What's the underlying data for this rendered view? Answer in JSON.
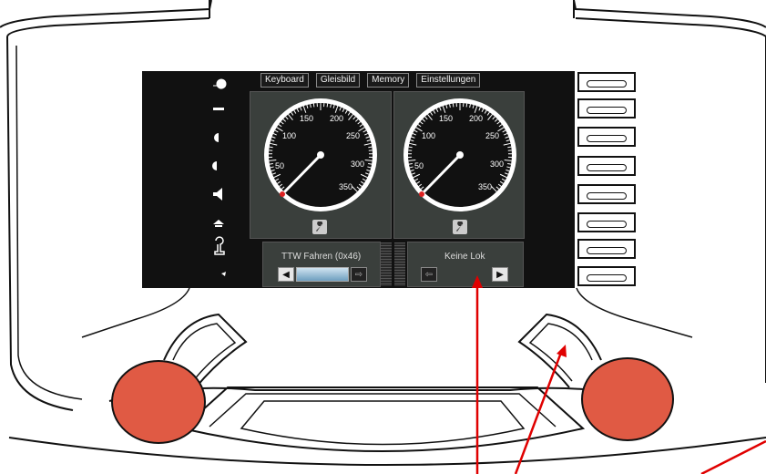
{
  "menu": {
    "items": [
      "Keyboard",
      "Gleisbild",
      "Memory",
      "Einstellungen"
    ]
  },
  "gauges": [
    {
      "ticks": [
        "50",
        "100",
        "150",
        "200",
        "250",
        "300",
        "350"
      ],
      "value": 0
    },
    {
      "ticks": [
        "50",
        "100",
        "150",
        "200",
        "250",
        "300",
        "350"
      ],
      "value": 0
    }
  ],
  "locos": {
    "left": {
      "name": "TTW Fahren (0x46)"
    },
    "right": {
      "name": "Keine Lok"
    }
  },
  "colors": {
    "knob": "#e05a44",
    "arrow": "#e00000",
    "panel": "#3a3f3c"
  },
  "icons": {
    "wrench": "wrench-icon",
    "left_keys": [
      "light-icon",
      "rear-light-icon",
      "half-light-icon",
      "cab-light-icon",
      "horn-icon",
      "bell-icon",
      "whistle-icon",
      "shunt-icon"
    ]
  }
}
